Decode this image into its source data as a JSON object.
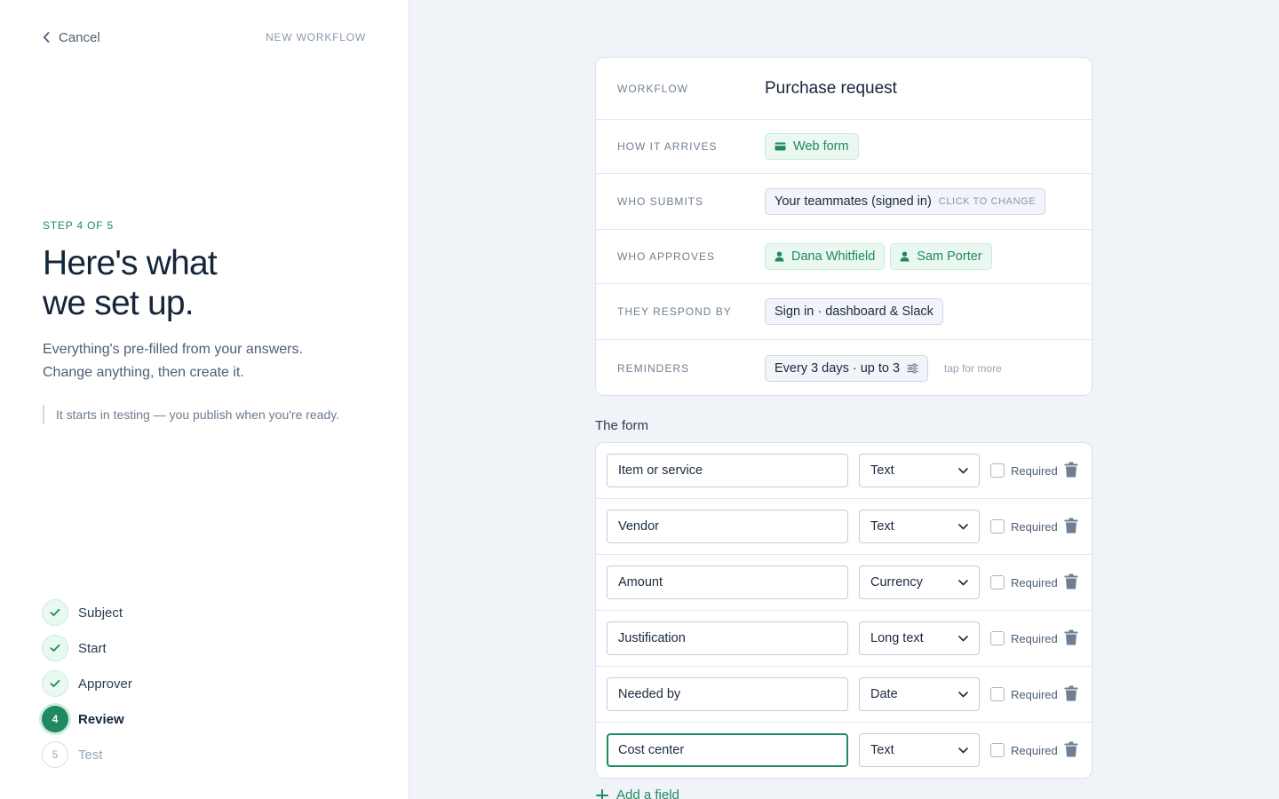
{
  "header": {
    "cancel_label": "Cancel",
    "context_label": "NEW WORKFLOW"
  },
  "intro": {
    "step_label": "STEP 4 OF 5",
    "heading_line1": "Here's what",
    "heading_line2": "we set up.",
    "subtitle_line1": "Everything's pre-filled from your answers.",
    "subtitle_line2": "Change anything, then create it.",
    "note": "It starts in testing — you publish when you're ready."
  },
  "steps": [
    {
      "label": "Subject",
      "state": "done",
      "marker": "check"
    },
    {
      "label": "Start",
      "state": "done",
      "marker": "check"
    },
    {
      "label": "Approver",
      "state": "done",
      "marker": "check"
    },
    {
      "label": "Review",
      "state": "active",
      "marker": "4"
    },
    {
      "label": "Test",
      "state": "todo",
      "marker": "5"
    }
  ],
  "summary": {
    "workflow": {
      "label": "WORKFLOW",
      "value": "Purchase request"
    },
    "arrives": {
      "label": "HOW IT ARRIVES",
      "value": "Web form",
      "icon": "card-icon"
    },
    "submits": {
      "label": "WHO SUBMITS",
      "value": "Your teammates (signed in)",
      "hint": "CLICK TO CHANGE"
    },
    "approves": {
      "label": "WHO APPROVES",
      "approvers": [
        "Dana Whitfield",
        "Sam Porter"
      ],
      "icon": "person-icon"
    },
    "respond": {
      "label": "THEY RESPOND BY",
      "value": "Sign in · dashboard & Slack"
    },
    "reminders": {
      "label": "REMINDERS",
      "value": "Every 3 days · up to 3",
      "icon": "sliders-icon",
      "tap_hint": "tap for more"
    }
  },
  "form": {
    "title": "The form",
    "required_label": "Required",
    "fields": [
      {
        "name": "Item or service",
        "type": "Text",
        "required": false
      },
      {
        "name": "Vendor",
        "type": "Text",
        "required": false
      },
      {
        "name": "Amount",
        "type": "Currency",
        "required": false
      },
      {
        "name": "Justification",
        "type": "Long text",
        "required": false
      },
      {
        "name": "Needed by",
        "type": "Date",
        "required": false
      },
      {
        "name": "Cost center",
        "type": "Text",
        "required": false,
        "focused": true
      }
    ],
    "add_label": "Add a field"
  },
  "colors": {
    "accent": "#1e8a5e",
    "accent_light": "#eaf8f1",
    "background": "#f0f3f8",
    "text_dark": "#14263b"
  }
}
